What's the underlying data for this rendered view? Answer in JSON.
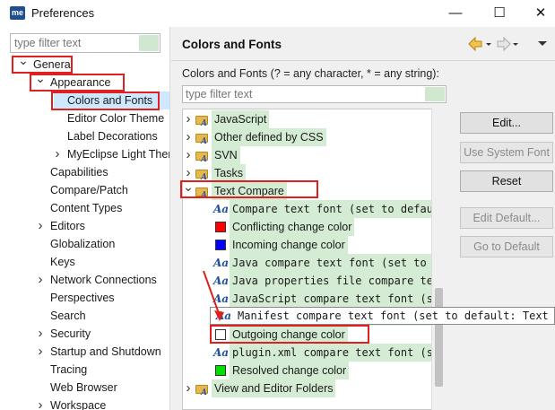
{
  "window": {
    "logo": "me",
    "title": "Preferences",
    "minimize_glyph": "—",
    "maximize_glyph": "☐",
    "close_glyph": "✕"
  },
  "left": {
    "filter_placeholder": "type filter text",
    "items": [
      {
        "label": "General",
        "chev": "v"
      },
      {
        "label": "Appearance",
        "chev": "v"
      },
      {
        "label": "Colors and Fonts",
        "chev": ""
      },
      {
        "label": "Editor Color Theme",
        "chev": ""
      },
      {
        "label": "Label Decorations",
        "chev": ""
      },
      {
        "label": "MyEclipse Light Theme",
        "chev": ">"
      },
      {
        "label": "Capabilities",
        "chev": ""
      },
      {
        "label": "Compare/Patch",
        "chev": ""
      },
      {
        "label": "Content Types",
        "chev": ""
      },
      {
        "label": "Editors",
        "chev": ">"
      },
      {
        "label": "Globalization",
        "chev": ""
      },
      {
        "label": "Keys",
        "chev": ""
      },
      {
        "label": "Network Connections",
        "chev": ">"
      },
      {
        "label": "Perspectives",
        "chev": ""
      },
      {
        "label": "Search",
        "chev": ""
      },
      {
        "label": "Security",
        "chev": ">"
      },
      {
        "label": "Startup and Shutdown",
        "chev": ">"
      },
      {
        "label": "Tracing",
        "chev": ""
      },
      {
        "label": "Web Browser",
        "chev": ""
      },
      {
        "label": "Workspace",
        "chev": ">"
      }
    ]
  },
  "right": {
    "title": "Colors and Fonts",
    "description": "Colors and Fonts (? = any character, * = any string):",
    "filter_placeholder": "type filter text",
    "tree": [
      {
        "type": "folder",
        "chev": ">",
        "label": "JavaScript"
      },
      {
        "type": "folder",
        "chev": ">",
        "label": "Other defined by CSS"
      },
      {
        "type": "folder",
        "chev": ">",
        "label": "SVN"
      },
      {
        "type": "folder",
        "chev": ">",
        "label": "Tasks"
      },
      {
        "type": "folder",
        "chev": "v",
        "label": "Text Compare"
      },
      {
        "type": "font",
        "label": "Compare text font (set to default: Text Font)"
      },
      {
        "type": "color",
        "color": "#ff0000",
        "label": "Conflicting change color"
      },
      {
        "type": "color",
        "color": "#0000ff",
        "label": "Incoming change color"
      },
      {
        "type": "font",
        "label": "Java compare text font (set to default: Text Font)"
      },
      {
        "type": "font",
        "label": "Java properties file compare text font"
      },
      {
        "type": "font",
        "label": "JavaScript compare text font (set to default: Text Font)"
      },
      {
        "type": "font",
        "label": "Manifest compare text font (set to default: Text Font)"
      },
      {
        "type": "color",
        "color": "#ffffff",
        "label": "Outgoing change color"
      },
      {
        "type": "font",
        "label": "plugin.xml compare text font (set to default: Text Font)"
      },
      {
        "type": "color",
        "color": "#00e000",
        "label": "Resolved change color"
      },
      {
        "type": "folder",
        "chev": ">",
        "label": "View and Editor Folders"
      }
    ],
    "tooltip": "Manifest compare text font (set to default: Text Font)",
    "buttons": {
      "edit": "Edit...",
      "use_system_font": "Use System Font",
      "reset": "Reset",
      "edit_default": "Edit Default...",
      "go_to_default": "Go to Default"
    }
  },
  "colors": {
    "annotation_red": "#e02020",
    "selection_blue": "#cde8ff",
    "match_green": "#d4ecd4"
  }
}
